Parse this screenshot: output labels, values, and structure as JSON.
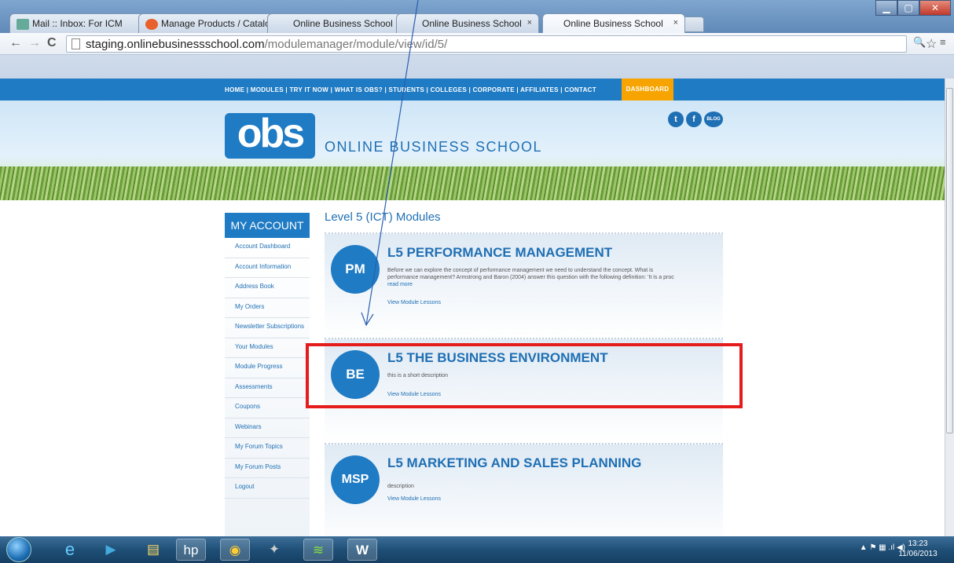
{
  "browser": {
    "tabs": [
      {
        "label": "Mail :: Inbox: For ICM",
        "favicon": "mail-icon"
      },
      {
        "label": "Manage Products / Catalo",
        "favicon": "magento-icon"
      },
      {
        "label": "Online Business School",
        "favicon": "none"
      },
      {
        "label": "Online Business School",
        "favicon": "none"
      },
      {
        "label": "Online Business School",
        "favicon": "none",
        "active": true
      }
    ],
    "url_host": "staging.onlinebusinessschool.com",
    "url_path": "/modulemanager/module/view/id/5/"
  },
  "site": {
    "nav_links": "HOME | MODULES | TRY IT NOW | WHAT IS OBS? | STUDENTS | COLLEGES | CORPORATE | AFFILIATES | CONTACT",
    "nav_dashboard": "DASHBOARD",
    "logo_text": "obs",
    "brand_name": "ONLINE BUSINESS SCHOOL",
    "social": {
      "twitter": "t",
      "facebook": "f",
      "blog": "BLOG"
    }
  },
  "sidebar": {
    "heading": "MY ACCOUNT",
    "items": [
      "Account Dashboard",
      "Account Information",
      "Address Book",
      "My Orders",
      "Newsletter Subscriptions",
      "Your Modules",
      "Module Progress",
      "Assessments",
      "Coupons",
      "Webinars",
      "My Forum Topics",
      "My Forum Posts",
      "Logout"
    ]
  },
  "content": {
    "title": "Level 5 (ICT) Modules",
    "modules": [
      {
        "badge": "PM",
        "title": "L5 PERFORMANCE MANAGEMENT",
        "description": "Before we can explore the concept of performance management we need to understand the concept. What is performance management? Armstrong and Baron (2004) answer this question with the following definition: 'It is a proc",
        "read_more": "read more",
        "view": "View Module Lessons"
      },
      {
        "badge": "BE",
        "title": "L5 THE BUSINESS ENVIRONMENT",
        "description": "this is a short description",
        "view": "View Module Lessons"
      },
      {
        "badge": "MSP",
        "title": "L5 MARKETING AND SALES PLANNING",
        "description": "description",
        "view": "View Module Lessons"
      }
    ]
  },
  "taskbar": {
    "clock_time": "13:23",
    "clock_date": "11/06/2013"
  },
  "colors": {
    "brand_blue": "#1f7bc4",
    "dashboard_orange": "#f7a400",
    "highlight_red": "#e51c1c"
  }
}
